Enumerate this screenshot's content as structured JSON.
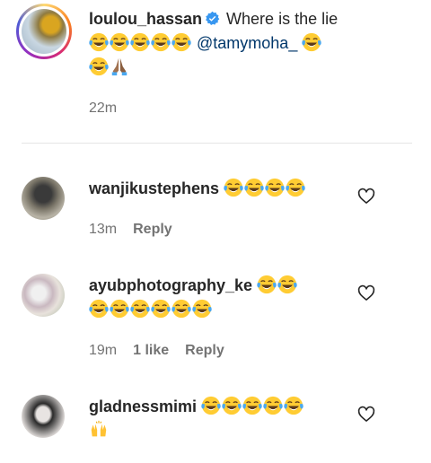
{
  "caption": {
    "username": "loulou_hassan",
    "text": "Where is the lie",
    "mention": "@tamymoha_",
    "time": "22m",
    "emoji": "face-with-tears-of-joy",
    "hands_emoji": "folded-hands"
  },
  "comments": [
    {
      "username": "wanjikustephens",
      "time": "13m",
      "reply": "Reply"
    },
    {
      "username": "ayubphotography_ke",
      "time": "19m",
      "likes": "1 like",
      "reply": "Reply"
    },
    {
      "username": "gladnessmimi",
      "emoji2": "raising-hands"
    }
  ],
  "colors": {
    "mention": "#00376b",
    "verified": "#3897f0",
    "meta": "#737373"
  }
}
